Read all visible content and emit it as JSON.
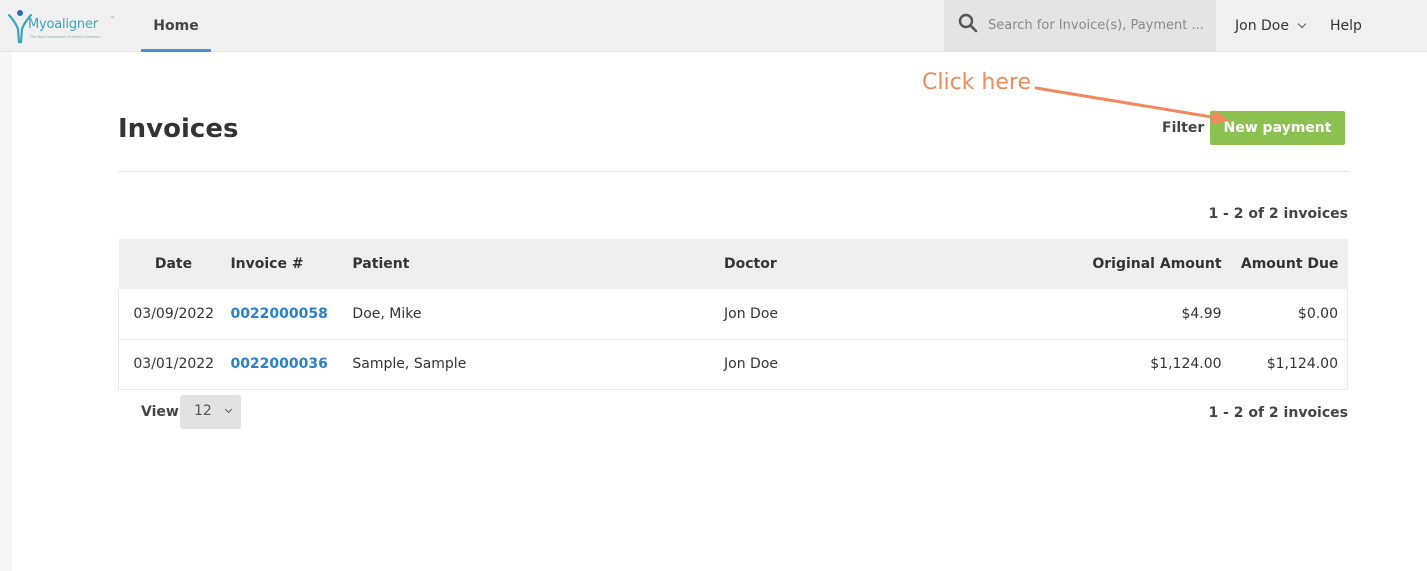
{
  "nav": {
    "logo_text": "Myoaligner",
    "logo_tm": "™",
    "logo_tagline": "The New Generation Of Dental Orthotics",
    "home_label": "Home",
    "search_placeholder": "Search for Invoice(s), Payment ...",
    "user_name": "Jon Doe",
    "help_label": "Help"
  },
  "header": {
    "title": "Invoices",
    "filter_label": "Filter",
    "new_payment_label": "New payment",
    "annotation_text": "Click here"
  },
  "pagination": {
    "summary_top": "1 - 2 of 2 invoices",
    "summary_bottom": "1 - 2 of 2 invoices",
    "view_label": "View",
    "view_value": "12"
  },
  "table": {
    "columns": [
      "Date",
      "Invoice #",
      "Patient",
      "Doctor",
      "Original Amount",
      "Amount Due"
    ],
    "rows": [
      {
        "date": "03/09/2022",
        "invoice": "0022000058",
        "patient": "Doe, Mike",
        "doctor": "Jon Doe",
        "original": "$4.99",
        "due": "$0.00"
      },
      {
        "date": "03/01/2022",
        "invoice": "0022000036",
        "patient": "Sample, Sample",
        "doctor": "Jon Doe",
        "original": "$1,124.00",
        "due": "$1,124.00"
      }
    ]
  },
  "colors": {
    "accent": "#8cc152",
    "link": "#2a80c9",
    "annotation": "#f08a5d",
    "nav_active": "#4a8fd4"
  }
}
